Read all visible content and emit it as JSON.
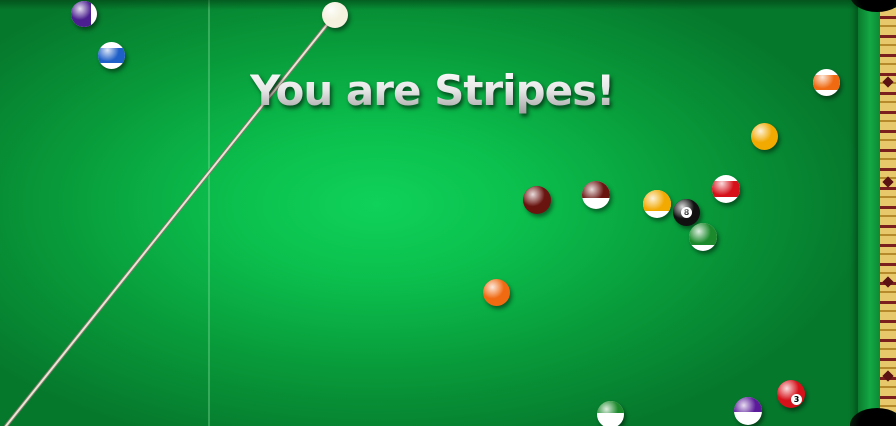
{
  "game": {
    "announcement": "You are Stripes!",
    "player_group": "stripes"
  },
  "colors": {
    "felt": "#0bbf4d",
    "cushion": "#13a845",
    "rail": "#e7c96b"
  },
  "balls": [
    {
      "id": "cue",
      "label": "",
      "color": "#f4f1de",
      "style": "solid"
    },
    {
      "id": "ball-4-stripe",
      "label": "",
      "color": "#4b1f8f",
      "style": "stripe"
    },
    {
      "id": "ball-10-stripe",
      "label": "",
      "color": "#1f5fc8",
      "style": "stripe"
    },
    {
      "id": "ball-13-stripe",
      "label": "",
      "color": "#f06a12",
      "style": "stripe"
    },
    {
      "id": "ball-1-solid",
      "label": "",
      "color": "#f2a900",
      "style": "solid"
    },
    {
      "id": "ball-7-solid",
      "label": "",
      "color": "#6a1410",
      "style": "solid"
    },
    {
      "id": "ball-15-stripe",
      "label": "",
      "color": "#6a1410",
      "style": "stripe"
    },
    {
      "id": "ball-9-stripe",
      "label": "",
      "color": "#f2a900",
      "style": "stripe"
    },
    {
      "id": "ball-8",
      "label": "8",
      "color": "#111111",
      "style": "solid"
    },
    {
      "id": "ball-11-stripe",
      "label": "",
      "color": "#d6111a",
      "style": "stripe"
    },
    {
      "id": "ball-14-stripe",
      "label": "",
      "color": "#1c8a2c",
      "style": "stripe"
    },
    {
      "id": "ball-5-solid",
      "label": "",
      "color": "#f06a12",
      "style": "solid"
    },
    {
      "id": "ball-3-solid",
      "label": "3",
      "color": "#d6111a",
      "style": "solid"
    },
    {
      "id": "ball-12-stripe",
      "label": "",
      "color": "#5a1a9a",
      "style": "stripe"
    },
    {
      "id": "ball-6-stripe",
      "label": "",
      "color": "#1c8a2c",
      "style": "stripe"
    }
  ]
}
